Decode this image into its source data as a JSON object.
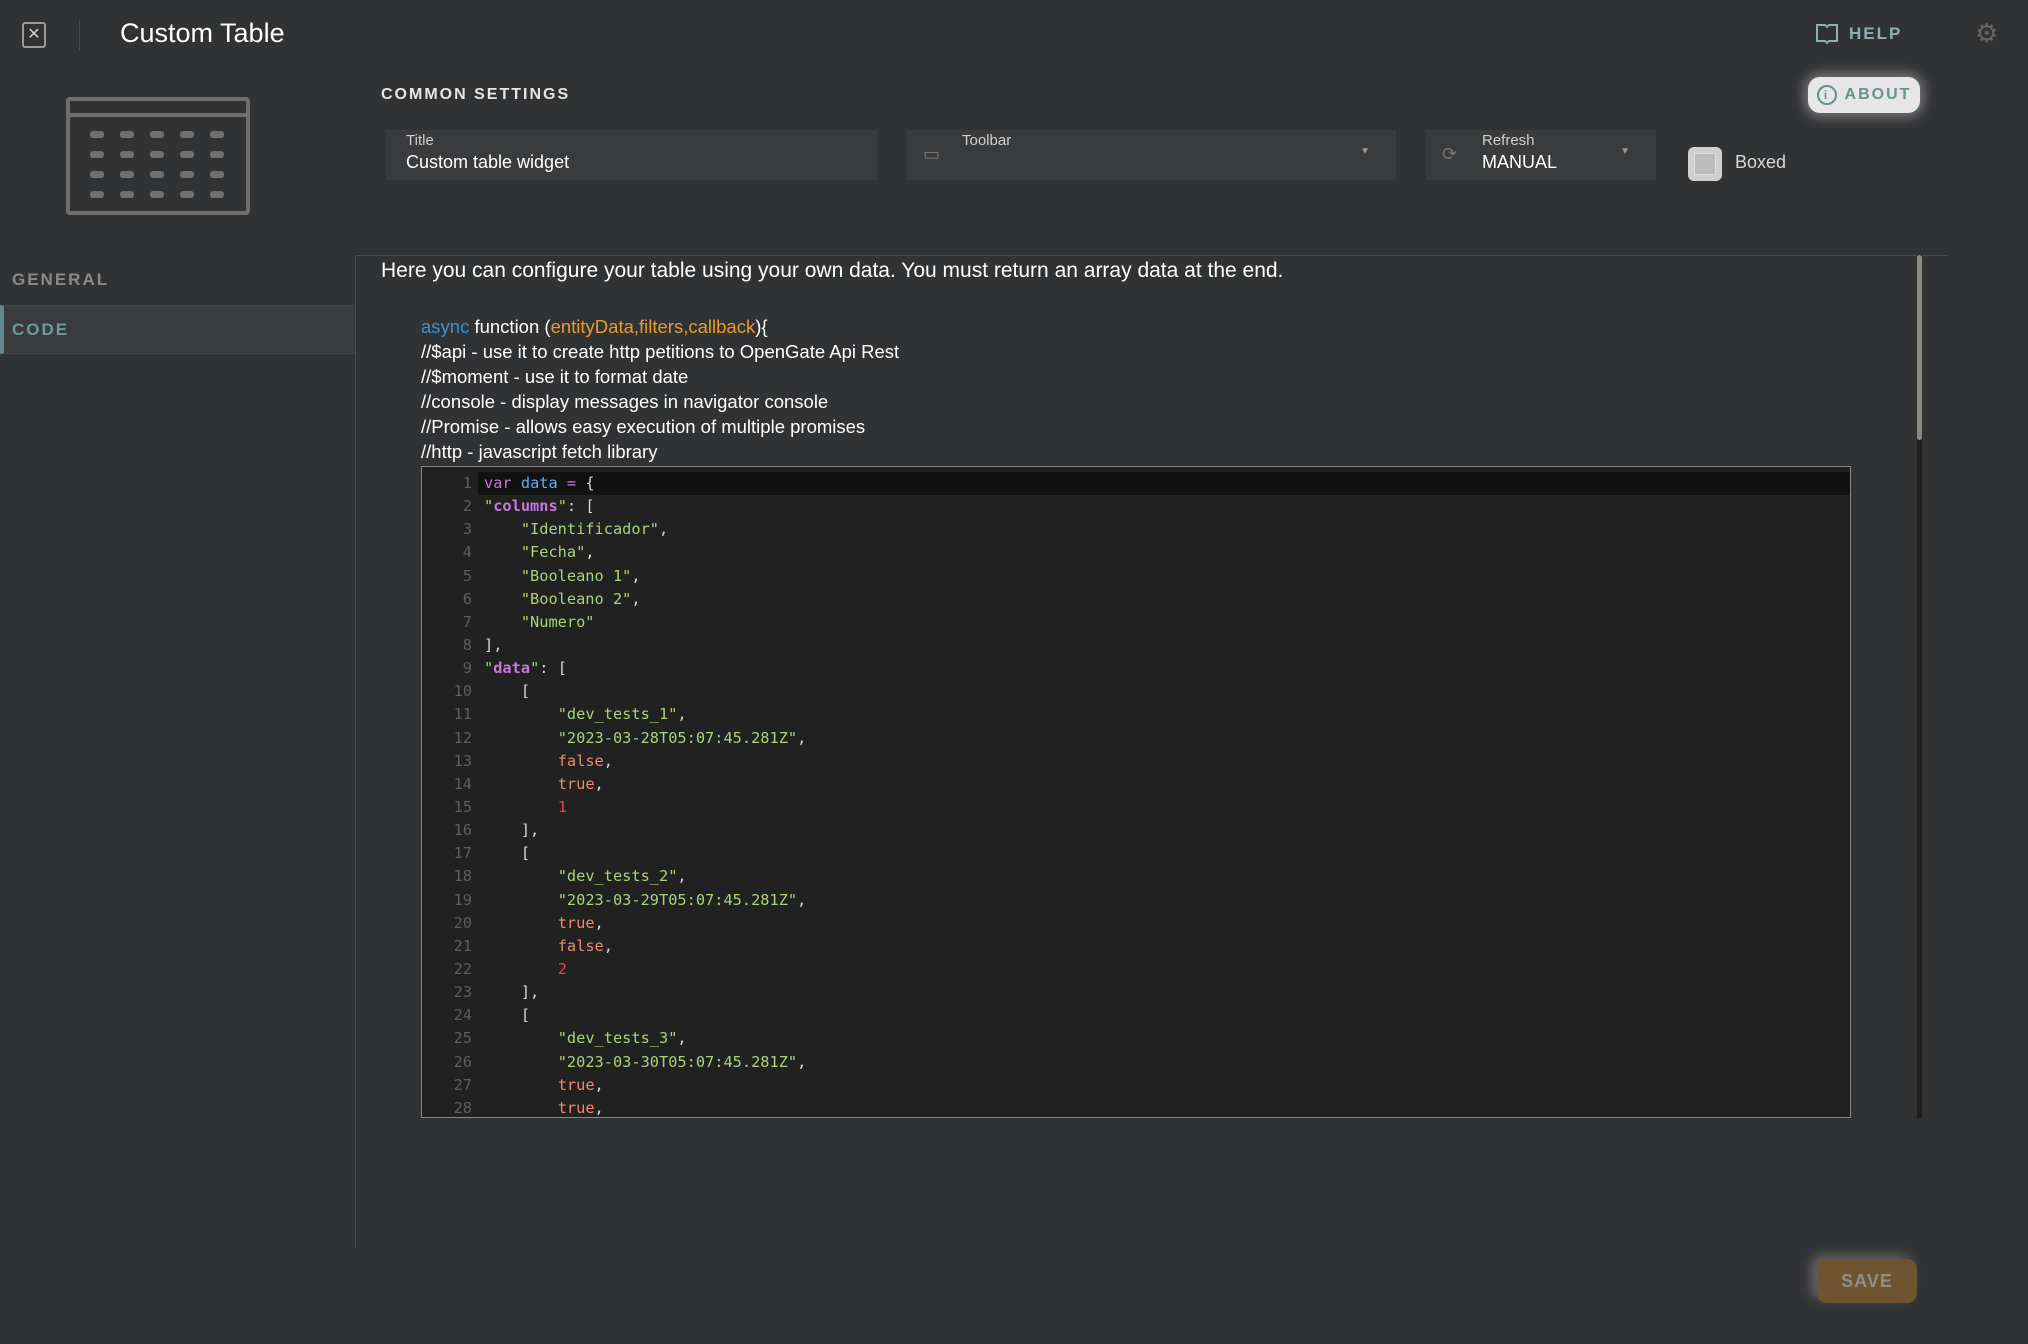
{
  "header": {
    "title": "Custom Table",
    "help_label": "HELP",
    "icons": [
      "close-icon",
      "help-book-icon",
      "gears-icon"
    ]
  },
  "settings": {
    "heading": "COMMON SETTINGS",
    "about_label": "ABOUT",
    "title_field": {
      "label": "Title",
      "value": "Custom table widget"
    },
    "toolbar_field": {
      "label": "Toolbar",
      "value": ""
    },
    "refresh_field": {
      "label": "Refresh",
      "value": "MANUAL"
    },
    "boxed": {
      "label": "Boxed",
      "checked": false
    }
  },
  "sidebar": {
    "items": [
      {
        "label": "GENERAL",
        "active": false
      },
      {
        "label": "CODE",
        "active": true
      }
    ]
  },
  "code": {
    "description": "Here you can configure your table using your own data. You must return an array data at the end.",
    "signature": {
      "keyword": "async",
      "fn": " function (",
      "args": "entityData,filters,callback",
      "end": "){"
    },
    "comments": [
      "//$api - use it to create http petitions to OpenGate Api Rest",
      "//$moment - use it to format date",
      "//console - display messages in navigator console",
      "//Promise - allows easy execution of multiple promises",
      "//http - javascript fetch library"
    ],
    "lines": [
      [
        [
          "var",
          "var"
        ],
        [
          "p",
          " "
        ],
        [
          "id",
          "data"
        ],
        [
          "p",
          " "
        ],
        [
          "var",
          "="
        ],
        [
          "p",
          " {"
        ]
      ],
      [
        [
          "str",
          "\""
        ],
        [
          "key",
          "columns"
        ],
        [
          "str",
          "\""
        ],
        [
          "p",
          ": ["
        ]
      ],
      [
        [
          "p",
          "    "
        ],
        [
          "str",
          "\"Identificador\""
        ],
        [
          "p",
          ","
        ]
      ],
      [
        [
          "p",
          "    "
        ],
        [
          "str",
          "\"Fecha\""
        ],
        [
          "p",
          ","
        ]
      ],
      [
        [
          "p",
          "    "
        ],
        [
          "str",
          "\"Booleano 1\""
        ],
        [
          "p",
          ","
        ]
      ],
      [
        [
          "p",
          "    "
        ],
        [
          "str",
          "\"Booleano 2\""
        ],
        [
          "p",
          ","
        ]
      ],
      [
        [
          "p",
          "    "
        ],
        [
          "str",
          "\"Numero\""
        ]
      ],
      [
        [
          "p",
          "],"
        ]
      ],
      [
        [
          "str",
          "\""
        ],
        [
          "key",
          "data"
        ],
        [
          "str",
          "\""
        ],
        [
          "p",
          ": ["
        ]
      ],
      [
        [
          "p",
          "    ["
        ]
      ],
      [
        [
          "p",
          "        "
        ],
        [
          "str",
          "\"dev_tests_1\""
        ],
        [
          "p",
          ","
        ]
      ],
      [
        [
          "p",
          "        "
        ],
        [
          "str",
          "\"2023-03-28T05:07:45.281Z\""
        ],
        [
          "p",
          ","
        ]
      ],
      [
        [
          "p",
          "        "
        ],
        [
          "bool",
          "false"
        ],
        [
          "p",
          ","
        ]
      ],
      [
        [
          "p",
          "        "
        ],
        [
          "bool",
          "true"
        ],
        [
          "p",
          ","
        ]
      ],
      [
        [
          "p",
          "        "
        ],
        [
          "num",
          "1"
        ]
      ],
      [
        [
          "p",
          "    ],"
        ]
      ],
      [
        [
          "p",
          "    ["
        ]
      ],
      [
        [
          "p",
          "        "
        ],
        [
          "str",
          "\"dev_tests_2\""
        ],
        [
          "p",
          ","
        ]
      ],
      [
        [
          "p",
          "        "
        ],
        [
          "str",
          "\"2023-03-29T05:07:45.281Z\""
        ],
        [
          "p",
          ","
        ]
      ],
      [
        [
          "p",
          "        "
        ],
        [
          "bool",
          "true"
        ],
        [
          "p",
          ","
        ]
      ],
      [
        [
          "p",
          "        "
        ],
        [
          "bool",
          "false"
        ],
        [
          "p",
          ","
        ]
      ],
      [
        [
          "p",
          "        "
        ],
        [
          "num",
          "2"
        ]
      ],
      [
        [
          "p",
          "    ],"
        ]
      ],
      [
        [
          "p",
          "    ["
        ]
      ],
      [
        [
          "p",
          "        "
        ],
        [
          "str",
          "\"dev_tests_3\""
        ],
        [
          "p",
          ","
        ]
      ],
      [
        [
          "p",
          "        "
        ],
        [
          "str",
          "\"2023-03-30T05:07:45.281Z\""
        ],
        [
          "p",
          ","
        ]
      ],
      [
        [
          "p",
          "        "
        ],
        [
          "bool",
          "true"
        ],
        [
          "p",
          ","
        ]
      ],
      [
        [
          "p",
          "        "
        ],
        [
          "bool",
          "true"
        ],
        [
          "p",
          ","
        ]
      ]
    ]
  },
  "footer": {
    "save_label": "SAVE"
  },
  "colors": {
    "accent": "#5f8b8b",
    "save": "#6e5530",
    "background": "#313234",
    "editor": "#212121"
  }
}
